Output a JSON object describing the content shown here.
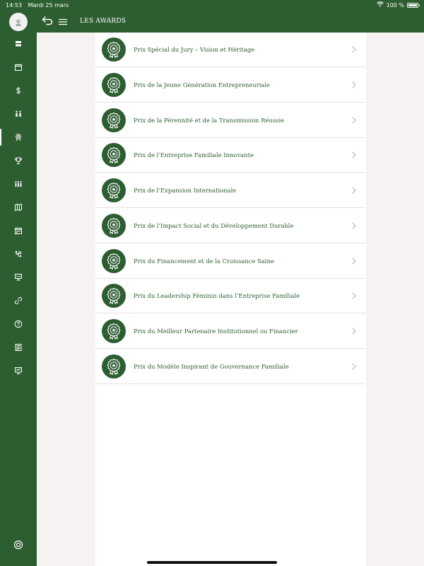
{
  "status_bar": {
    "time": "14:53",
    "date": "Mardi 25 mars",
    "battery": "100 %",
    "battery_level": 1.0
  },
  "header": {
    "title": "LES AWARDS",
    "back_icon": "back-arrow-icon",
    "menu_icon": "hamburger-menu-icon"
  },
  "sidebar": {
    "avatar_icon": "user-icon",
    "icons": [
      "stack-icon",
      "calendar-icon",
      "dollar-icon",
      "people-icon",
      "award-icon",
      "trophy-icon",
      "group-icon",
      "map-icon",
      "calendar-grid-icon",
      "network-icon",
      "presentation-icon",
      "link-icon",
      "help-icon",
      "document-icon",
      "screen-icon"
    ],
    "active_index": 4,
    "logout_icon": "power-icon"
  },
  "awards": [
    "Prix Spécial du Jury – Vision et Héritage",
    "Prix de la Jeune Génération Entrepreneuriale",
    "Prix de la Pérennité et de la Transmission Réussie",
    "Prix de l’Entreprise Familiale Innovante",
    "Prix de l’Expansion Internationale",
    "Prix de l’Impact Social et du Développement Durable",
    "Prix du Financement et de la Croissance Saine",
    "Prix du Leadership Féminin dans l’Entreprise Familiale",
    "Prix du Meilleur Partenaire Institutionnel ou Financier",
    "Prix du Modèle Inspirant de Gouvernance Familiale"
  ],
  "colors": {
    "brand_green": "#2d5e31",
    "background": "#f5f2f1",
    "card": "#ffffff"
  }
}
